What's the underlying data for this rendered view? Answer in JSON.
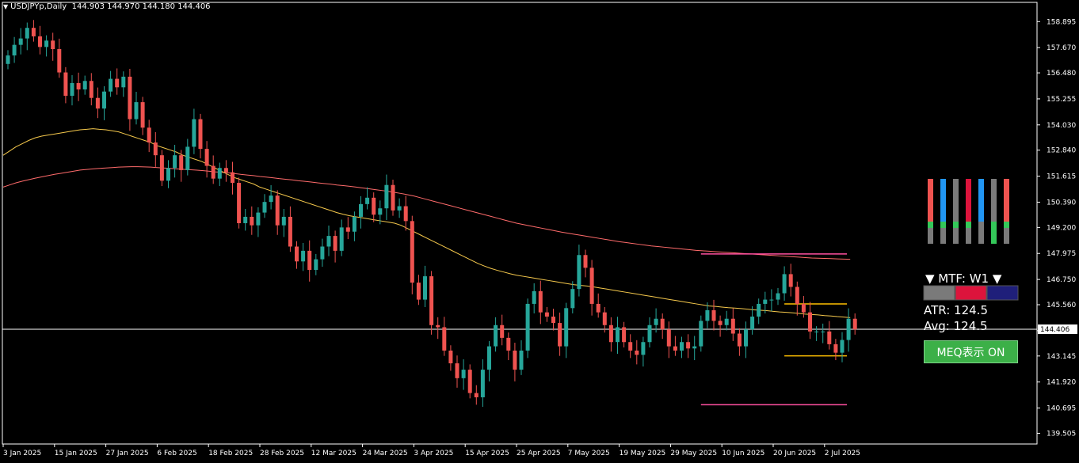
{
  "header": {
    "symbol": "USDJPYp,Daily",
    "ohlc": "144.903 144.970 144.180 144.406"
  },
  "colors": {
    "background": "#000000",
    "bull": "#26a69a",
    "bear": "#ef5350",
    "ma_fast": "#f6c94c",
    "ma_slow": "#ff6b6b",
    "level_pink": "#ff4fa0",
    "level_yellow": "#ffc000",
    "price_line": "#ffffff"
  },
  "chart_data": {
    "type": "candlestick",
    "ylim": [
      139.0,
      159.8
    ],
    "y_ticks": [
      "158.895",
      "157.670",
      "156.480",
      "155.255",
      "154.030",
      "152.840",
      "151.615",
      "150.390",
      "149.200",
      "147.975",
      "146.750",
      "145.560",
      "144.335",
      "143.145",
      "141.920",
      "140.695",
      "139.505"
    ],
    "y_tick_values": [
      158.895,
      157.67,
      156.48,
      155.255,
      154.03,
      152.84,
      151.615,
      150.39,
      149.2,
      147.975,
      146.75,
      145.56,
      144.335,
      143.145,
      141.92,
      140.695,
      139.505
    ],
    "x_ticks": [
      {
        "label": "3 Jan 2025",
        "i": 0
      },
      {
        "label": "15 Jan 2025",
        "i": 8
      },
      {
        "label": "27 Jan 2025",
        "i": 16
      },
      {
        "label": "6 Feb 2025",
        "i": 24
      },
      {
        "label": "18 Feb 2025",
        "i": 32
      },
      {
        "label": "28 Feb 2025",
        "i": 40
      },
      {
        "label": "12 Mar 2025",
        "i": 48
      },
      {
        "label": "24 Mar 2025",
        "i": 56
      },
      {
        "label": "3 Apr 2025",
        "i": 64
      },
      {
        "label": "15 Apr 2025",
        "i": 72
      },
      {
        "label": "25 Apr 2025",
        "i": 80
      },
      {
        "label": "7 May 2025",
        "i": 88
      },
      {
        "label": "19 May 2025",
        "i": 96
      },
      {
        "label": "29 May 2025",
        "i": 104
      },
      {
        "label": "10 Jun 2025",
        "i": 112
      },
      {
        "label": "20 Jun 2025",
        "i": 120
      },
      {
        "label": "2 Jul 2025",
        "i": 128
      }
    ],
    "current_price": 144.406,
    "current_price_label": "144.406",
    "closes": [
      157.3,
      157.8,
      158.1,
      158.6,
      158.2,
      157.7,
      158.0,
      157.6,
      156.5,
      155.4,
      156.0,
      155.7,
      156.1,
      155.3,
      154.8,
      155.6,
      156.2,
      155.8,
      156.3,
      154.3,
      155.1,
      153.9,
      153.2,
      152.6,
      151.4,
      152.0,
      152.6,
      151.9,
      153.0,
      154.3,
      152.9,
      152.1,
      151.5,
      152.0,
      151.8,
      151.3,
      149.4,
      149.7,
      149.3,
      149.9,
      150.4,
      150.7,
      149.3,
      149.7,
      148.3,
      147.6,
      148.1,
      147.2,
      147.7,
      148.3,
      148.8,
      148.1,
      149.2,
      149.0,
      149.7,
      150.3,
      150.6,
      149.8,
      150.1,
      151.2,
      150.0,
      150.2,
      149.5,
      146.6,
      145.8,
      146.9,
      144.6,
      144.5,
      143.4,
      142.8,
      142.1,
      142.5,
      141.4,
      141.2,
      142.5,
      143.6,
      144.6,
      144.0,
      143.4,
      142.5,
      143.4,
      145.6,
      146.2,
      145.2,
      145.0,
      144.7,
      143.6,
      145.4,
      146.3,
      147.9,
      147.3,
      145.6,
      145.2,
      144.6,
      143.8,
      144.5,
      143.8,
      143.4,
      143.2,
      143.8,
      144.6,
      144.9,
      144.4,
      143.6,
      143.4,
      143.8,
      143.5,
      143.6,
      144.8,
      145.3,
      144.8,
      144.6,
      144.9,
      144.2,
      143.6,
      144.4,
      145.0,
      145.6,
      145.8,
      145.8,
      146.1,
      147.0,
      146.4,
      145.6,
      145.2,
      144.3,
      144.3,
      144.3,
      143.7,
      143.3,
      143.9,
      144.9,
      144.4
    ],
    "ma_fast": [
      152.6,
      152.8,
      153.0,
      153.15,
      153.3,
      153.42,
      153.5,
      153.55,
      153.6,
      153.65,
      153.7,
      153.75,
      153.8,
      153.82,
      153.85,
      153.82,
      153.8,
      153.75,
      153.7,
      153.6,
      153.5,
      153.4,
      153.3,
      153.2,
      153.05,
      152.95,
      152.85,
      152.75,
      152.6,
      152.5,
      152.4,
      152.3,
      152.15,
      152.0,
      151.85,
      151.7,
      151.55,
      151.45,
      151.35,
      151.25,
      151.1,
      151.0,
      150.9,
      150.8,
      150.7,
      150.6,
      150.5,
      150.4,
      150.3,
      150.2,
      150.1,
      150.0,
      149.9,
      149.82,
      149.75,
      149.7,
      149.65,
      149.6,
      149.55,
      149.5,
      149.45,
      149.4,
      149.3,
      149.15,
      149.0,
      148.85,
      148.7,
      148.55,
      148.4,
      148.25,
      148.1,
      147.95,
      147.8,
      147.65,
      147.5,
      147.38,
      147.27,
      147.18,
      147.1,
      147.02,
      146.95,
      146.9,
      146.85,
      146.8,
      146.75,
      146.7,
      146.65,
      146.6,
      146.55,
      146.5,
      146.47,
      146.44,
      146.4,
      146.35,
      146.3,
      146.25,
      146.2,
      146.15,
      146.1,
      146.05,
      146.0,
      145.95,
      145.9,
      145.85,
      145.8,
      145.75,
      145.7,
      145.65,
      145.6,
      145.55,
      145.5,
      145.48,
      145.45,
      145.42,
      145.4,
      145.38,
      145.35,
      145.32,
      145.3,
      145.28,
      145.25,
      145.22,
      145.2,
      145.18,
      145.15,
      145.12,
      145.1,
      145.08,
      145.05,
      145.03,
      145.0,
      144.98,
      144.95
    ],
    "ma_slow": [
      151.1,
      151.2,
      151.3,
      151.38,
      151.45,
      151.52,
      151.58,
      151.64,
      151.7,
      151.75,
      151.8,
      151.85,
      151.9,
      151.93,
      151.96,
      151.98,
      152.0,
      152.02,
      152.04,
      152.05,
      152.06,
      152.06,
      152.05,
      152.04,
      152.02,
      152.0,
      151.98,
      151.96,
      151.94,
      151.92,
      151.9,
      151.88,
      151.85,
      151.82,
      151.8,
      151.77,
      151.74,
      151.7,
      151.67,
      151.64,
      151.6,
      151.57,
      151.54,
      151.5,
      151.47,
      151.44,
      151.4,
      151.37,
      151.34,
      151.3,
      151.27,
      151.24,
      151.2,
      151.17,
      151.14,
      151.1,
      151.06,
      151.02,
      150.98,
      150.94,
      150.9,
      150.85,
      150.8,
      150.74,
      150.68,
      150.6,
      150.52,
      150.44,
      150.36,
      150.28,
      150.2,
      150.12,
      150.04,
      149.96,
      149.88,
      149.8,
      149.72,
      149.64,
      149.56,
      149.48,
      149.4,
      149.34,
      149.28,
      149.22,
      149.16,
      149.1,
      149.04,
      148.98,
      148.93,
      148.88,
      148.83,
      148.78,
      148.73,
      148.68,
      148.63,
      148.58,
      148.53,
      148.49,
      148.45,
      148.41,
      148.37,
      148.33,
      148.3,
      148.27,
      148.24,
      148.21,
      148.18,
      148.15,
      148.12,
      148.1,
      148.08,
      148.06,
      148.04,
      148.02,
      148.0,
      147.98,
      147.96,
      147.94,
      147.92,
      147.9,
      147.88,
      147.86,
      147.84,
      147.82,
      147.8,
      147.78,
      147.76,
      147.75,
      147.74,
      147.73,
      147.72,
      147.71,
      147.7
    ],
    "levels": [
      {
        "price": 147.95,
        "from": 108,
        "to": 130,
        "color": "level_pink"
      },
      {
        "price": 145.6,
        "from": 121,
        "to": 130,
        "color": "level_yellow"
      },
      {
        "price": 143.15,
        "from": 121,
        "to": 130,
        "color": "level_yellow"
      },
      {
        "price": 140.85,
        "from": 108,
        "to": 130,
        "color": "level_pink"
      }
    ]
  },
  "mtf_panel": {
    "title": "▼ MTF: W1 ▼",
    "atr": "ATR: 124.5",
    "avg": "Avg: 124.5",
    "button": "MEQ表示 ON",
    "swatches": [
      "#7a7a7a",
      "#dc143c",
      "#1f1f7a"
    ],
    "bars": [
      [
        "#ef5350",
        "#ef5350",
        "#34c759",
        "#7a7a7a"
      ],
      [
        "#2196f3",
        "#2196f3",
        "#34c759",
        "#7a7a7a"
      ],
      [
        "#7a7a7a",
        "#7a7a7a",
        "#34c759",
        "#7a7a7a"
      ],
      [
        "#dc143c",
        "#dc143c",
        "#34c759",
        "#7a7a7a"
      ],
      [
        "#2196f3",
        "#2196f3",
        "#7a7a7a",
        "#7a7a7a"
      ],
      [
        "#7a7a7a",
        "#7a7a7a",
        "#34c759",
        "#34c759"
      ],
      [
        "#ef5350",
        "#ef5350",
        "#34c759",
        "#7a7a7a"
      ]
    ]
  }
}
